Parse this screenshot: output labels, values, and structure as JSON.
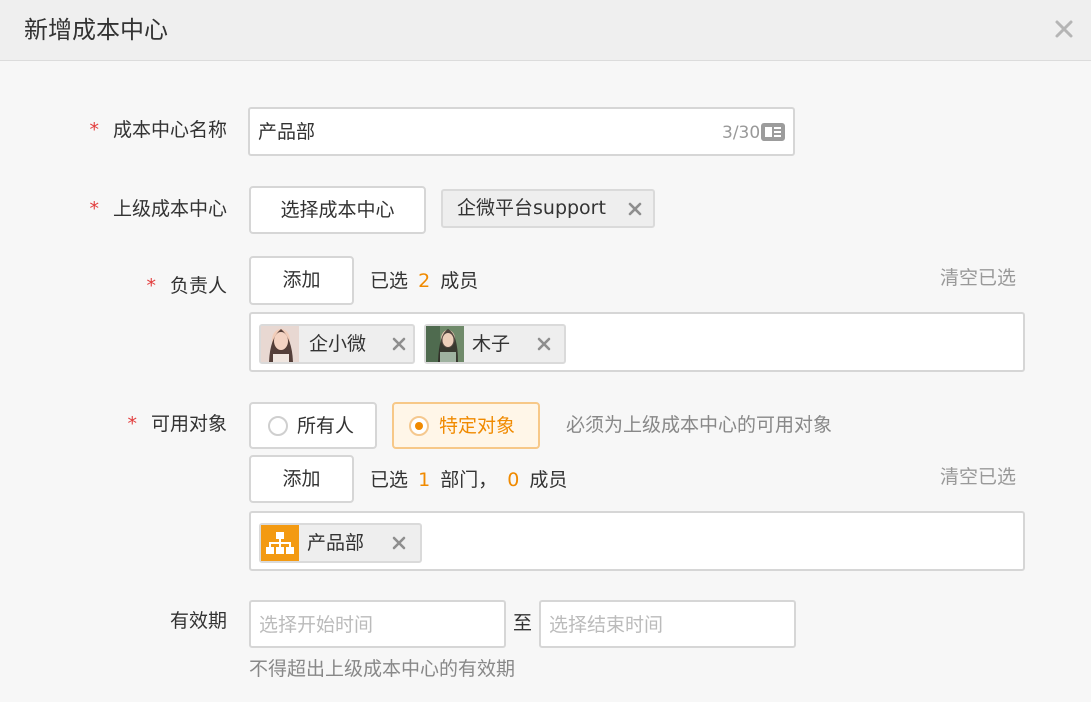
{
  "dialog": {
    "title": "新增成本中心",
    "close_icon": "close-icon"
  },
  "form": {
    "name": {
      "required_mark": "*",
      "label": "成本中心名称",
      "value": "产品部",
      "counter": "3/30"
    },
    "parent": {
      "required_mark": "*",
      "label": "上级成本中心",
      "select_button": "选择成本中心",
      "selected_chip": "企微平台support"
    },
    "owner": {
      "required_mark": "*",
      "label": "负责人",
      "add_button": "添加",
      "selected_prefix": "已选",
      "selected_count": "2",
      "selected_suffix": "成员",
      "clear_link": "清空已选",
      "members": [
        {
          "name": "企小微"
        },
        {
          "name": "木子"
        }
      ]
    },
    "scope": {
      "required_mark": "*",
      "label": "可用对象",
      "options": [
        {
          "label": "所有人",
          "selected": false
        },
        {
          "label": "特定对象",
          "selected": true
        }
      ],
      "hint": "必须为上级成本中心的可用对象",
      "add_button": "添加",
      "selected_prefix": "已选",
      "dept_count": "1",
      "dept_suffix": "部门，",
      "member_count": "0",
      "member_suffix": "成员",
      "clear_link": "清空已选",
      "departments": [
        {
          "name": "产品部",
          "icon": "org-chart-icon"
        }
      ]
    },
    "validity": {
      "label": "有效期",
      "start_placeholder": "选择开始时间",
      "separator": "至",
      "end_placeholder": "选择结束时间",
      "hint": "不得超出上级成本中心的有效期"
    }
  },
  "colors": {
    "accent": "#f08a00",
    "required": "#e23c3c",
    "header_bg": "#efefef",
    "page_bg": "#f7f7f7"
  }
}
